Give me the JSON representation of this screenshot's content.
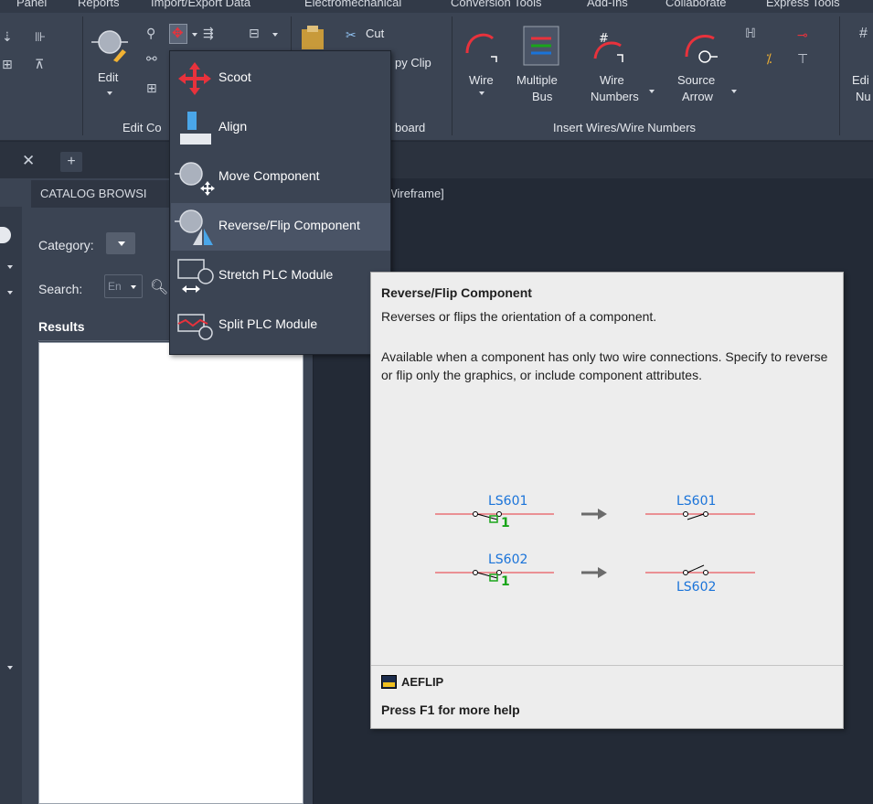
{
  "menu_tabs": [
    "Panel",
    "Reports",
    "Import/Export Data",
    "Electromechanical",
    "Conversion Tools",
    "Add-Ins",
    "Collaborate",
    "Express Tools"
  ],
  "ribbon": {
    "edit_label": "Edit",
    "panel_edit_components": "Edit Co",
    "clipboard_cut": "Cut",
    "clipboard_copy": "py Clip",
    "panel_clipboard": "board",
    "wire_label": "Wire",
    "multiple_bus_line1": "Multiple",
    "multiple_bus_line2": "Bus",
    "wire_numbers_line1": "Wire",
    "wire_numbers_line2": "Numbers",
    "source_arrow_line1": "Source",
    "source_arrow_line2": "Arrow",
    "panel_insert_wires": "Insert Wires/Wire Numbers",
    "edit_num_line1": "Edi",
    "edit_num_line2": "Nu"
  },
  "palette": {
    "title": "CATALOG BROWSI",
    "category_label": "Category:",
    "search_label": "Search:",
    "search_lang": "En",
    "results_label": "Results"
  },
  "viewport_label": "] Wireframe]",
  "flyout": {
    "items": [
      {
        "label": "Scoot"
      },
      {
        "label": "Align"
      },
      {
        "label": "Move Component"
      },
      {
        "label": "Reverse/Flip Component"
      },
      {
        "label": "Stretch PLC Module"
      },
      {
        "label": "Split PLC Module"
      }
    ],
    "active_index": 3
  },
  "tooltip": {
    "title": "Reverse/Flip Component",
    "description": "Reverses or flips the orientation of a component.",
    "detail": "Available when a component has only two wire connections. Specify to reverse or flip only the graphics, or include component attributes.",
    "illustration": {
      "tag1": "LS601",
      "tag2": "LS602",
      "pin_number": "1"
    },
    "command": "AEFLIP",
    "help": "Press F1 for more help"
  },
  "colors": {
    "wire_red": "#e8323c",
    "tag_blue": "#1a73d9",
    "pin_green": "#1aa51a",
    "arrow_gray": "#6b6b6b",
    "scoot_red": "#e8323c",
    "align_blue": "#4aa6e8"
  }
}
